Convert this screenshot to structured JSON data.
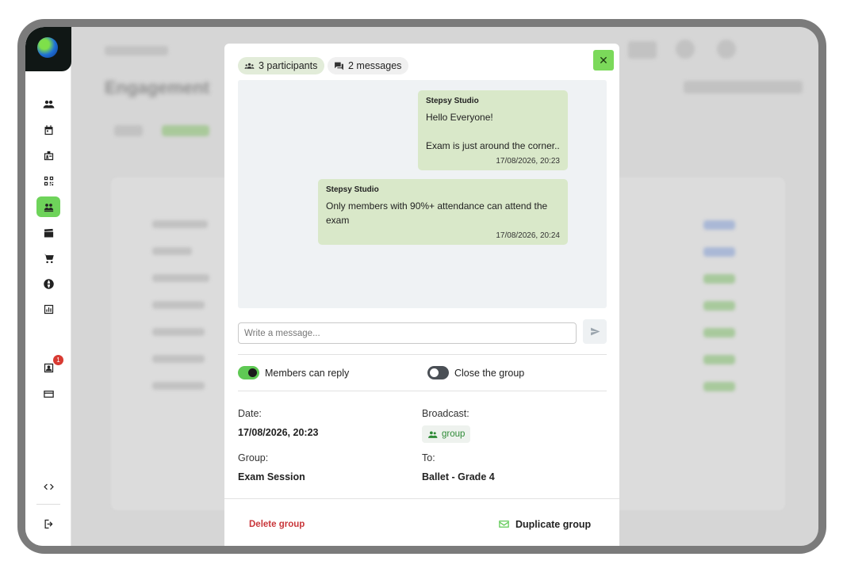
{
  "background_page": {
    "title": "Engagement"
  },
  "sidebar": {
    "items": [
      {
        "icon": "people-icon"
      },
      {
        "icon": "calendar-icon"
      },
      {
        "icon": "id-badge-icon"
      },
      {
        "icon": "qr-code-icon"
      },
      {
        "icon": "groups-icon",
        "active": true
      },
      {
        "icon": "clapperboard-icon"
      },
      {
        "icon": "cart-icon"
      },
      {
        "icon": "globe-icon"
      },
      {
        "icon": "chart-icon"
      },
      {
        "icon": "account-icon",
        "badge": "1"
      },
      {
        "icon": "credit-card-icon"
      },
      {
        "icon": "code-icon"
      },
      {
        "icon": "logout-icon"
      }
    ]
  },
  "modal": {
    "participants_label": "3 participants",
    "messages_label": "2 messages",
    "close_label": "✕",
    "messages": [
      {
        "sender": "Stepsy Studio",
        "text": "Hello Everyone!\n\nExam is just around the corner..",
        "time": "17/08/2026, 20:23"
      },
      {
        "sender": "Stepsy Studio",
        "text": "Only members with 90%+ attendance can attend the exam",
        "time": "17/08/2026, 20:24"
      }
    ],
    "input": {
      "placeholder": "Write a message...",
      "value": ""
    },
    "toggles": {
      "members_can_reply": {
        "label": "Members can reply",
        "on": true
      },
      "close_group": {
        "label": "Close the group",
        "on": false
      }
    },
    "details": {
      "date_label": "Date:",
      "date_value": "17/08/2026, 20:23",
      "broadcast_label": "Broadcast:",
      "broadcast_value": "group",
      "group_label": "Group:",
      "group_value": "Exam Session",
      "to_label": "To:",
      "to_value": "Ballet - Grade 4"
    },
    "footer": {
      "delete_label": "Delete group",
      "duplicate_label": "Duplicate group"
    }
  },
  "colors": {
    "accent_green": "#7bd95a",
    "bubble_green": "#d9e8c9",
    "danger_red": "#c9373b",
    "toggle_on": "#5fc954"
  }
}
